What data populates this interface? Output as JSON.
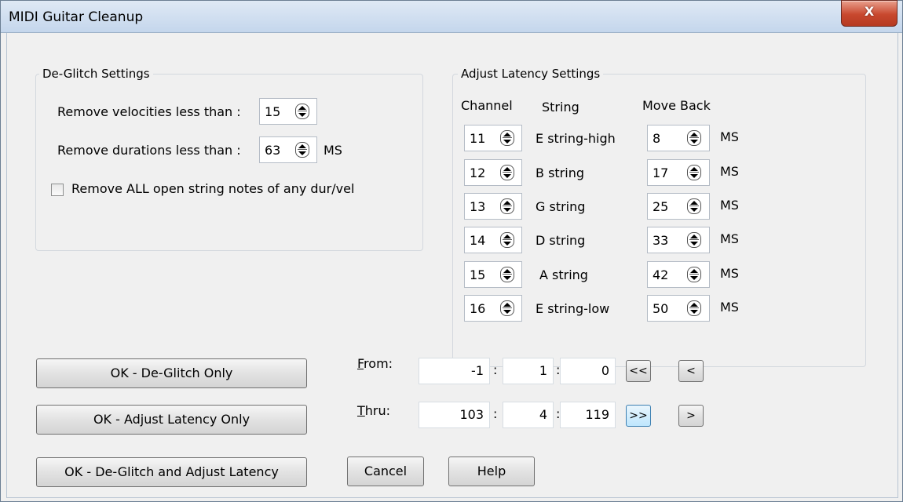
{
  "window": {
    "title": "MIDI Guitar Cleanup",
    "close_glyph": "X"
  },
  "deglitch": {
    "legend": "De-Glitch Settings",
    "velocity_label": "Remove velocities less than :",
    "velocity_value": "15",
    "duration_label": "Remove durations less than :",
    "duration_value": "63",
    "duration_unit": "MS",
    "open_string_label": "Remove ALL open string notes of any dur/vel",
    "open_string_checked": false
  },
  "latency": {
    "legend": "Adjust Latency Settings",
    "col_channel": "Channel",
    "col_string": "String",
    "col_moveback": "Move Back",
    "rows": [
      {
        "channel": "11",
        "string": "E string-high",
        "move": "8",
        "unit": "MS"
      },
      {
        "channel": "12",
        "string": "B string",
        "move": "17",
        "unit": "MS"
      },
      {
        "channel": "13",
        "string": "G string",
        "move": "25",
        "unit": "MS"
      },
      {
        "channel": "14",
        "string": "D string",
        "move": "33",
        "unit": "MS"
      },
      {
        "channel": "15",
        "string": "A string",
        "move": "42",
        "unit": "MS"
      },
      {
        "channel": "16",
        "string": "E string-low",
        "move": "50",
        "unit": "MS"
      }
    ]
  },
  "buttons": {
    "deglitch_only": "OK - De-Glitch Only",
    "latency_only": "OK - Adjust Latency Only",
    "both": "OK - De-Glitch and Adjust Latency",
    "cancel": "Cancel",
    "help": "Help"
  },
  "range": {
    "from_key": "F",
    "from_rest": "rom:",
    "thru_key": "T",
    "thru_rest": "hru:",
    "sep": ":",
    "from": {
      "bar": "-1",
      "beat": "1",
      "tick": "0"
    },
    "thru": {
      "bar": "103",
      "beat": "4",
      "tick": "119"
    },
    "first": "<<",
    "prev": "<",
    "last": ">>",
    "next": ">"
  }
}
